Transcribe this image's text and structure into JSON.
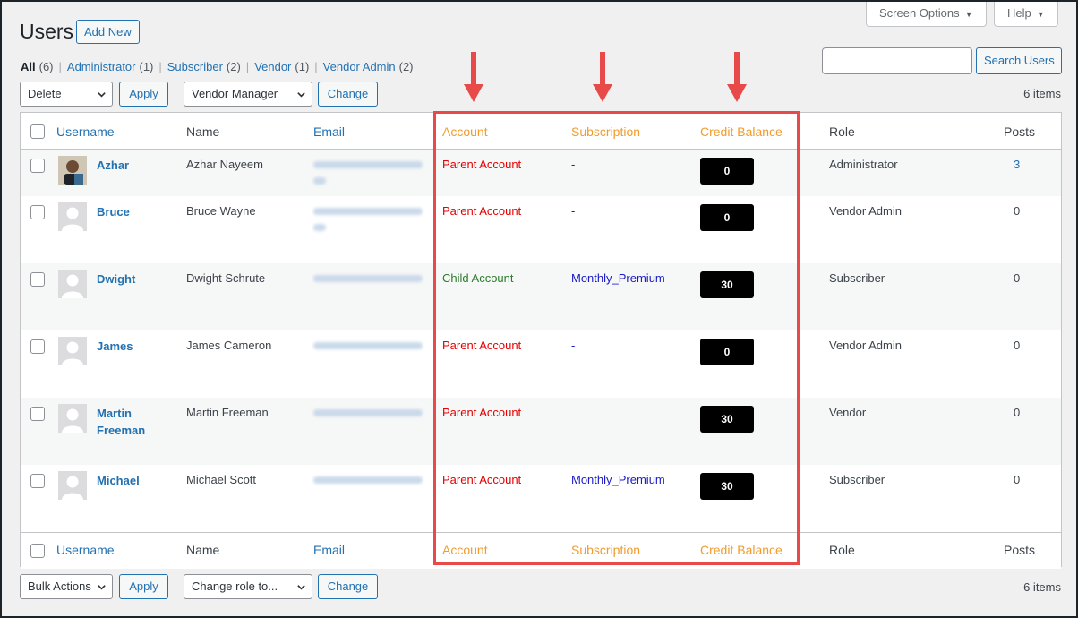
{
  "screen_options": {
    "label": "Screen Options",
    "caret": "▼"
  },
  "help": {
    "label": "Help",
    "caret": "▼"
  },
  "page": {
    "title": "Users",
    "add_new": "Add New"
  },
  "filters": [
    {
      "label": "All",
      "count": "(6)",
      "current": true
    },
    {
      "label": "Administrator",
      "count": "(1)"
    },
    {
      "label": "Subscriber",
      "count": "(2)"
    },
    {
      "label": "Vendor",
      "count": "(1)"
    },
    {
      "label": "Vendor Admin",
      "count": "(2)"
    }
  ],
  "filter_separator": "|",
  "search": {
    "value": "",
    "button": "Search Users"
  },
  "top_nav": {
    "bulk_action": "Delete",
    "apply": "Apply",
    "role_select": "Vendor Manager",
    "change": "Change",
    "items_count": "6 items"
  },
  "bottom_nav": {
    "bulk_action": "Bulk Actions",
    "apply": "Apply",
    "role_select": "Change role to...",
    "change": "Change",
    "items_count": "6 items"
  },
  "columns": {
    "username": "Username",
    "name": "Name",
    "email": "Email",
    "account": "Account",
    "subscription": "Subscription",
    "credit_balance": "Credit Balance",
    "role": "Role",
    "posts": "Posts"
  },
  "highlight_color": "#e84a4a",
  "header_accent_color": "#f29c2b",
  "rows": [
    {
      "username": "Azhar",
      "name": "Azhar Nayeem",
      "account": "Parent Account",
      "account_type": "parent",
      "subscription": "-",
      "credit": "0",
      "role": "Administrator",
      "posts": "3",
      "avatar": "photo"
    },
    {
      "username": "Bruce",
      "name": "Bruce Wayne",
      "account": "Parent Account",
      "account_type": "parent",
      "subscription": "-",
      "credit": "0",
      "role": "Vendor Admin",
      "posts": "0",
      "avatar": "placeholder"
    },
    {
      "username": "Dwight",
      "name": "Dwight Schrute",
      "account": "Child Account",
      "account_type": "child",
      "subscription": "Monthly_Premium",
      "credit": "30",
      "role": "Subscriber",
      "posts": "0",
      "avatar": "placeholder"
    },
    {
      "username": "James",
      "name": "James Cameron",
      "account": "Parent Account",
      "account_type": "parent",
      "subscription": "-",
      "credit": "0",
      "role": "Vendor Admin",
      "posts": "0",
      "avatar": "placeholder"
    },
    {
      "username": "Martin",
      "username_line2": "Freeman",
      "name": "Martin Freeman",
      "account": "Parent Account",
      "account_type": "parent",
      "subscription": "",
      "credit": "30",
      "role": "Vendor",
      "posts": "0",
      "avatar": "placeholder"
    },
    {
      "username": "Michael",
      "name": "Michael Scott",
      "account": "Parent Account",
      "account_type": "parent",
      "subscription": "Monthly_Premium",
      "credit": "30",
      "role": "Subscriber",
      "posts": "0",
      "avatar": "placeholder"
    }
  ]
}
